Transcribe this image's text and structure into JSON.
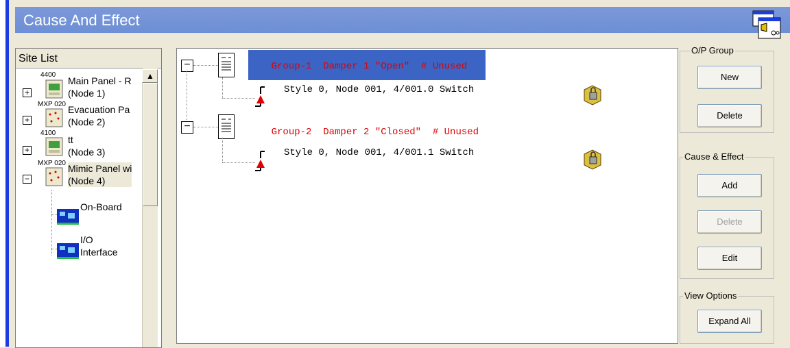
{
  "window": {
    "title": "Cause And Effect"
  },
  "site_list": {
    "header": "Site List",
    "nodes": [
      {
        "code": "4400",
        "name": "Main Panel - R",
        "node": "(Node 1)",
        "expander": "+"
      },
      {
        "code": "MXP 020",
        "name": "Evacuation Pa",
        "node": "(Node 2)",
        "expander": "+"
      },
      {
        "code": "4100",
        "name": "tt",
        "node": "(Node 3)",
        "expander": "+"
      },
      {
        "code": "MXP 020",
        "name": "Mimic Panel wi",
        "node": "(Node 4)",
        "expander": "−"
      }
    ],
    "children": [
      {
        "label": "On-Board"
      },
      {
        "label1": "I/O",
        "label2": "Interface"
      }
    ],
    "scroll_up_glyph": "▲"
  },
  "groups": [
    {
      "label": "Group-1  Damper 1 \"Open\"  # Unused",
      "selected": true,
      "switch": "Style 0, Node 001, 4/001.0 Switch",
      "expander": "−"
    },
    {
      "label": "Group-2  Damper 2 \"Closed\"  # Unused",
      "selected": false,
      "switch": "Style 0, Node 001, 4/001.1 Switch",
      "expander": "−"
    }
  ],
  "right_panel": {
    "op_group": {
      "legend": "O/P Group",
      "new": "New",
      "delete": "Delete"
    },
    "cause_effect": {
      "legend": "Cause & Effect",
      "add": "Add",
      "delete": "Delete",
      "edit": "Edit"
    },
    "view_options": {
      "legend": "View Options",
      "expand_all": "Expand All"
    }
  },
  "colors": {
    "title_bg": "#7c98d8",
    "group_text": "#e00000",
    "selection": "#3b64c4"
  }
}
